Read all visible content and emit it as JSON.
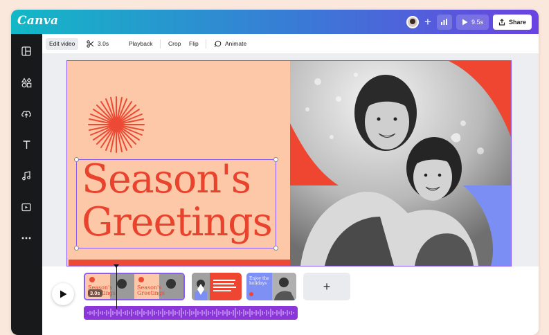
{
  "app": {
    "logo": "Canva"
  },
  "topbar": {
    "play_duration": "9.5s",
    "share_label": "Share",
    "icons": [
      "avatar",
      "plus-icon",
      "chart-icon",
      "play-icon",
      "share-icon"
    ]
  },
  "sidebar": {
    "items": [
      {
        "name": "templates",
        "icon": "layout-icon"
      },
      {
        "name": "elements",
        "icon": "shapes-icon"
      },
      {
        "name": "uploads",
        "icon": "cloud-upload-icon"
      },
      {
        "name": "text",
        "icon": "text-icon"
      },
      {
        "name": "audio",
        "icon": "music-icon"
      },
      {
        "name": "videos",
        "icon": "video-icon"
      },
      {
        "name": "more",
        "icon": "more-icon"
      }
    ]
  },
  "toolbar": {
    "edit_video": "Edit video",
    "duration": "3.0s",
    "playback": "Playback",
    "crop": "Crop",
    "flip": "Flip",
    "animate": "Animate"
  },
  "canvas": {
    "heading_line1": "Season's",
    "heading_line2": "Greetings",
    "colors": {
      "peach": "#fcc8a8",
      "red": "#e9422d",
      "blue": "#7f90f5",
      "selection": "#8a5cf6"
    }
  },
  "timeline": {
    "clip1_duration": "3.0s",
    "clip3_text": "Enjoy the holidays",
    "add_label": "+"
  }
}
